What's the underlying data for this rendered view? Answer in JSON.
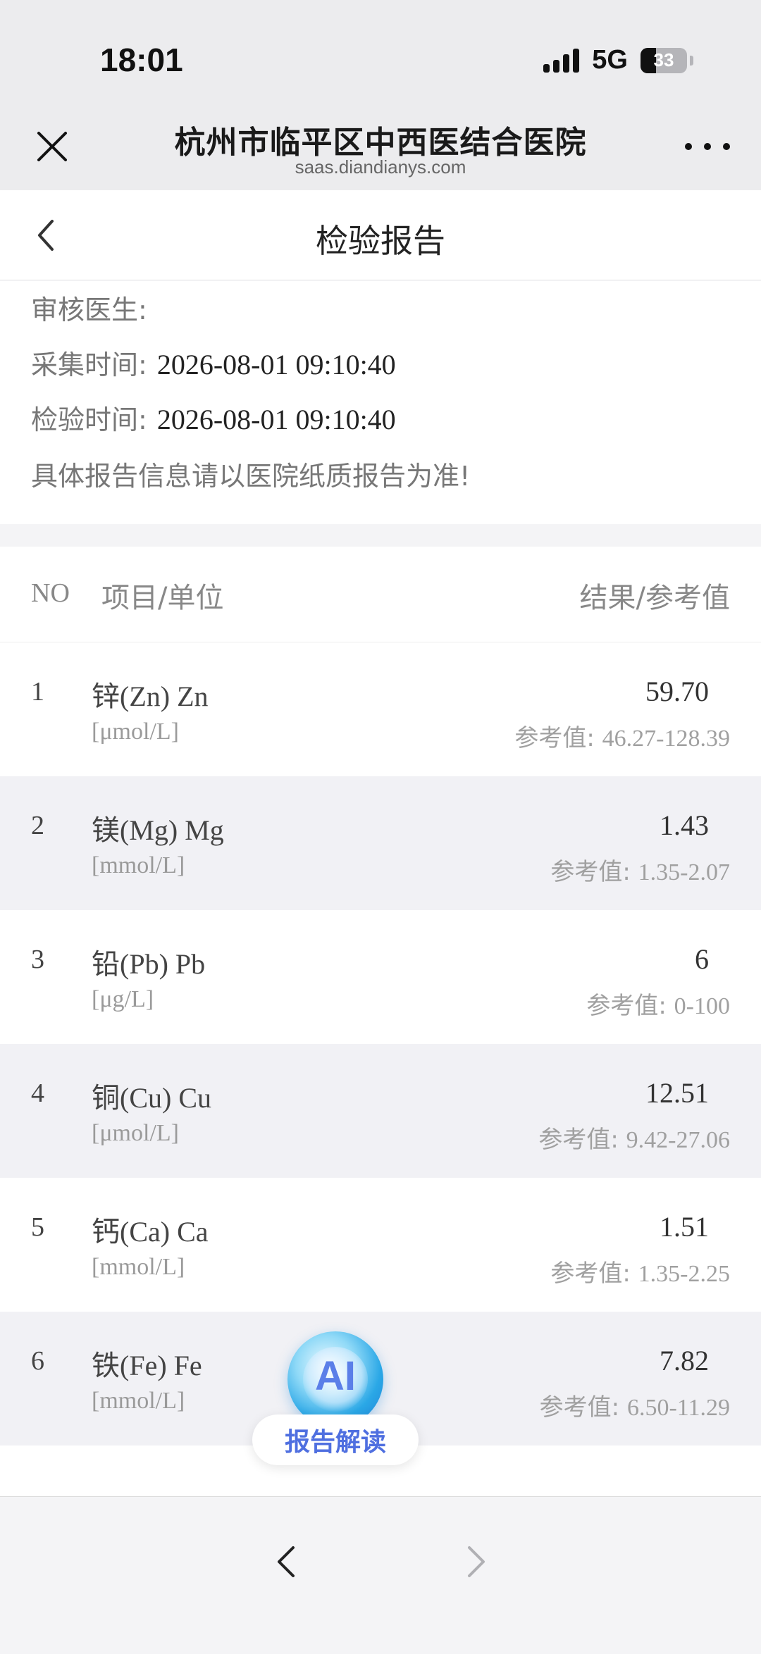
{
  "status_bar": {
    "time": "18:01",
    "network": "5G",
    "battery_percent": "33"
  },
  "browser": {
    "title": "杭州市临平区中西医结合医院",
    "domain": "saas.diandianys.com",
    "close_icon": "close-icon",
    "more_icon": "more-icon"
  },
  "page": {
    "title": "检验报告",
    "back_icon": "chevron-left-icon"
  },
  "info": {
    "doctor_label": "审核医生:",
    "doctor_value": "",
    "collect_label": "采集时间:",
    "collect_value": "2026-08-01 09:10:40",
    "test_label": "检验时间:",
    "test_value": "2026-08-01 09:10:40",
    "notice": "具体报告信息请以医院纸质报告为准!"
  },
  "table": {
    "col_no": "NO",
    "col_item": "项目/单位",
    "col_result": "结果/参考值",
    "ref_prefix": "参考值:",
    "rows": [
      {
        "no": "1",
        "name": "锌(Zn) Zn",
        "unit": "[μmol/L]",
        "value": "59.70",
        "ref": "46.27-128.39"
      },
      {
        "no": "2",
        "name": "镁(Mg) Mg",
        "unit": "[mmol/L]",
        "value": "1.43",
        "ref": "1.35-2.07"
      },
      {
        "no": "3",
        "name": "铅(Pb) Pb",
        "unit": "[μg/L]",
        "value": "6",
        "ref": "0-100"
      },
      {
        "no": "4",
        "name": "铜(Cu) Cu",
        "unit": "[μmol/L]",
        "value": "12.51",
        "ref": "9.42-27.06"
      },
      {
        "no": "5",
        "name": "钙(Ca) Ca",
        "unit": "[mmol/L]",
        "value": "1.51",
        "ref": "1.35-2.25"
      },
      {
        "no": "6",
        "name": "铁(Fe) Fe",
        "unit": "[mmol/L]",
        "value": "7.82",
        "ref": "6.50-11.29"
      }
    ]
  },
  "ai_button": {
    "badge": "AI",
    "label": "报告解读"
  },
  "toolbar": {
    "back_icon": "chevron-left-icon",
    "forward_icon": "chevron-right-icon"
  },
  "colors": {
    "ai_accent": "#4f6fe0",
    "row_alt_bg": "#f1f1f5"
  }
}
